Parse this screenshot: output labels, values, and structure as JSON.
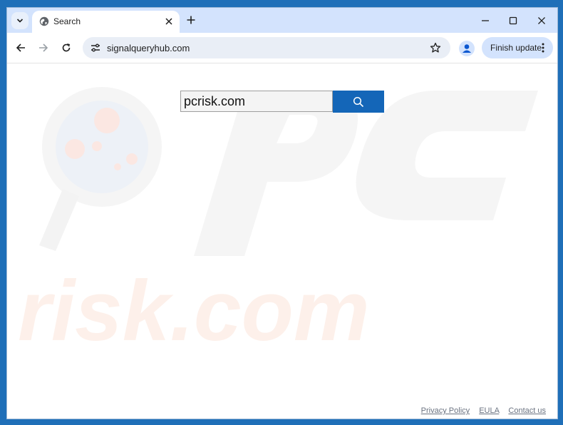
{
  "browser": {
    "tab_title": "Search",
    "url": "signalqueryhub.com",
    "finish_update_label": "Finish update"
  },
  "page": {
    "search_value": "pcrisk.com",
    "footer_links": [
      "Privacy Policy",
      "EULA",
      "Contact us"
    ],
    "watermark_text": "risk.com"
  },
  "icons": {
    "tab_search": "chevron-down-icon",
    "tab_favicon": "globe-icon",
    "tab_close": "close-icon",
    "new_tab": "plus-icon",
    "minimize": "minimize-icon",
    "maximize": "maximize-icon",
    "close_window": "close-icon",
    "back": "arrow-left-icon",
    "forward": "arrow-right-icon",
    "reload": "reload-icon",
    "site_info": "tune-icon",
    "bookmark": "star-icon",
    "profile": "person-icon",
    "menu": "more-vertical-icon",
    "search": "search-icon"
  },
  "colors": {
    "tabstrip": "#d3e3fd",
    "omnibox": "#e9eef6",
    "search_button": "#1466b8",
    "desktop": "#1f6fb8"
  }
}
